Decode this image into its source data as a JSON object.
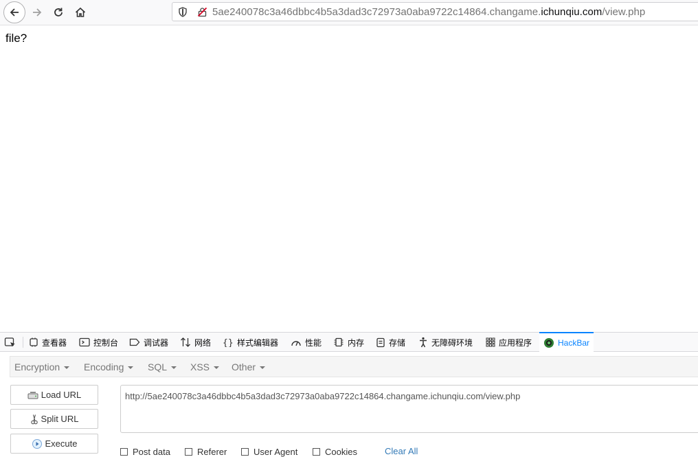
{
  "browser": {
    "url_prefix": "5ae240078c3a46dbbc4b5a3dad3c72973a0aba9722c14864.changame.",
    "url_domain": "ichunqiu.com",
    "url_path": "/view.php"
  },
  "page": {
    "body_text": "file?"
  },
  "devtools": {
    "tabs": [
      {
        "label": "查看器",
        "icon": "inspector-icon"
      },
      {
        "label": "控制台",
        "icon": "console-icon"
      },
      {
        "label": "调试器",
        "icon": "debugger-icon"
      },
      {
        "label": "网络",
        "icon": "network-icon"
      },
      {
        "label": "样式编辑器",
        "icon": "style-editor-icon"
      },
      {
        "label": "性能",
        "icon": "performance-icon"
      },
      {
        "label": "内存",
        "icon": "memory-icon"
      },
      {
        "label": "存储",
        "icon": "storage-icon"
      },
      {
        "label": "无障碍环境",
        "icon": "accessibility-icon"
      },
      {
        "label": "应用程序",
        "icon": "application-icon"
      },
      {
        "label": "HackBar",
        "icon": "hackbar-icon"
      }
    ],
    "active_tab": "HackBar"
  },
  "hackbar": {
    "menu": [
      "Encryption",
      "Encoding",
      "SQL",
      "XSS",
      "Other"
    ],
    "buttons": {
      "load_url": "Load URL",
      "split_url": "Split URL",
      "execute": "Execute"
    },
    "url_value": "http://5ae240078c3a46dbbc4b5a3dad3c72973a0aba9722c14864.changame.ichunqiu.com/view.php",
    "options": {
      "post_data": "Post data",
      "referer": "Referer",
      "user_agent": "User Agent",
      "cookies": "Cookies"
    },
    "clear_all": "Clear All"
  },
  "colors": {
    "active_tab": "#0a84ff",
    "link": "#337ab7"
  }
}
